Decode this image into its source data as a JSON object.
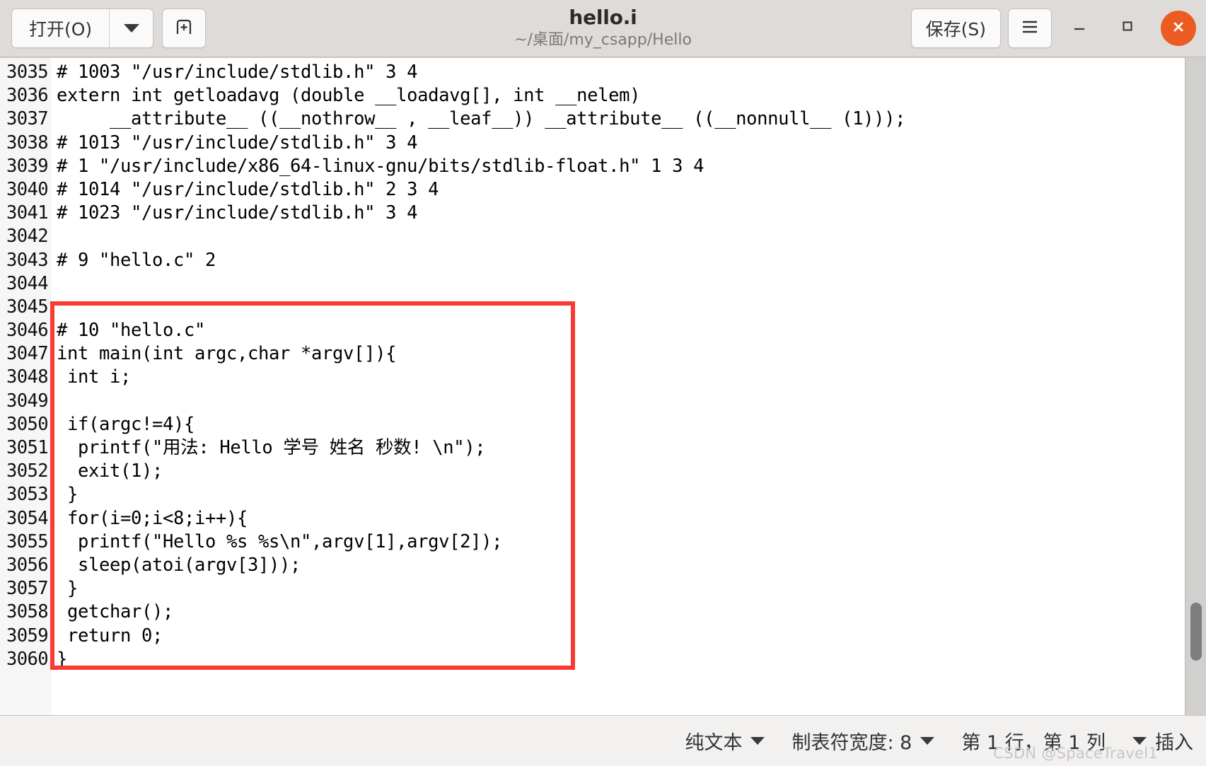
{
  "window": {
    "title": "hello.i",
    "subtitle": "~/桌面/my_csapp/Hello",
    "accent_close": "#ec5b21",
    "annotation_box_color": "#f93a33"
  },
  "headerbar": {
    "open_label": "打开(O)",
    "open_dropdown_icon": "chevron-down-icon",
    "new_document_icon": "new-document-icon",
    "save_label": "保存(S)",
    "menu_icon": "hamburger-menu-icon",
    "minimize_icon": "minimize-icon",
    "maximize_icon": "maximize-icon",
    "close_icon": "close-icon",
    "minimize_glyph": "—",
    "maximize_glyph": "□",
    "close_glyph": "✕",
    "menu_glyph": "☰"
  },
  "editor": {
    "first_line_number": 3035,
    "lines": [
      {
        "n": "3035",
        "text": "# 1003 \"/usr/include/stdlib.h\" 3 4"
      },
      {
        "n": "3036",
        "text": "extern int getloadavg (double __loadavg[], int __nelem)"
      },
      {
        "n": "3037",
        "text": "     __attribute__ ((__nothrow__ , __leaf__)) __attribute__ ((__nonnull__ (1)));"
      },
      {
        "n": "3038",
        "text": "# 1013 \"/usr/include/stdlib.h\" 3 4"
      },
      {
        "n": "3039",
        "text": "# 1 \"/usr/include/x86_64-linux-gnu/bits/stdlib-float.h\" 1 3 4"
      },
      {
        "n": "3040",
        "text": "# 1014 \"/usr/include/stdlib.h\" 2 3 4"
      },
      {
        "n": "3041",
        "text": "# 1023 \"/usr/include/stdlib.h\" 3 4"
      },
      {
        "n": "3042",
        "text": ""
      },
      {
        "n": "3043",
        "text": "# 9 \"hello.c\" 2"
      },
      {
        "n": "3044",
        "text": ""
      },
      {
        "n": "3045",
        "text": ""
      },
      {
        "n": "3046",
        "text": "# 10 \"hello.c\""
      },
      {
        "n": "3047",
        "text": "int main(int argc,char *argv[]){"
      },
      {
        "n": "3048",
        "text": " int i;"
      },
      {
        "n": "3049",
        "text": ""
      },
      {
        "n": "3050",
        "text": " if(argc!=4){"
      },
      {
        "n": "3051",
        "text": "  printf(\"用法: Hello 学号 姓名 秒数! \\n\");"
      },
      {
        "n": "3052",
        "text": "  exit(1);"
      },
      {
        "n": "3053",
        "text": " }"
      },
      {
        "n": "3054",
        "text": " for(i=0;i<8;i++){"
      },
      {
        "n": "3055",
        "text": "  printf(\"Hello %s %s\\n\",argv[1],argv[2]);"
      },
      {
        "n": "3056",
        "text": "  sleep(atoi(argv[3]));"
      },
      {
        "n": "3057",
        "text": " }"
      },
      {
        "n": "3058",
        "text": " getchar();"
      },
      {
        "n": "3059",
        "text": " return 0;"
      },
      {
        "n": "3060",
        "text": "}"
      }
    ]
  },
  "statusbar": {
    "syntax_label": "纯文本",
    "tab_width_label": "制表符宽度: 8",
    "position_label": "第 1 行，第 1 列",
    "insert_label": "插入",
    "watermark": "CSDN @SpaceTravel1"
  }
}
